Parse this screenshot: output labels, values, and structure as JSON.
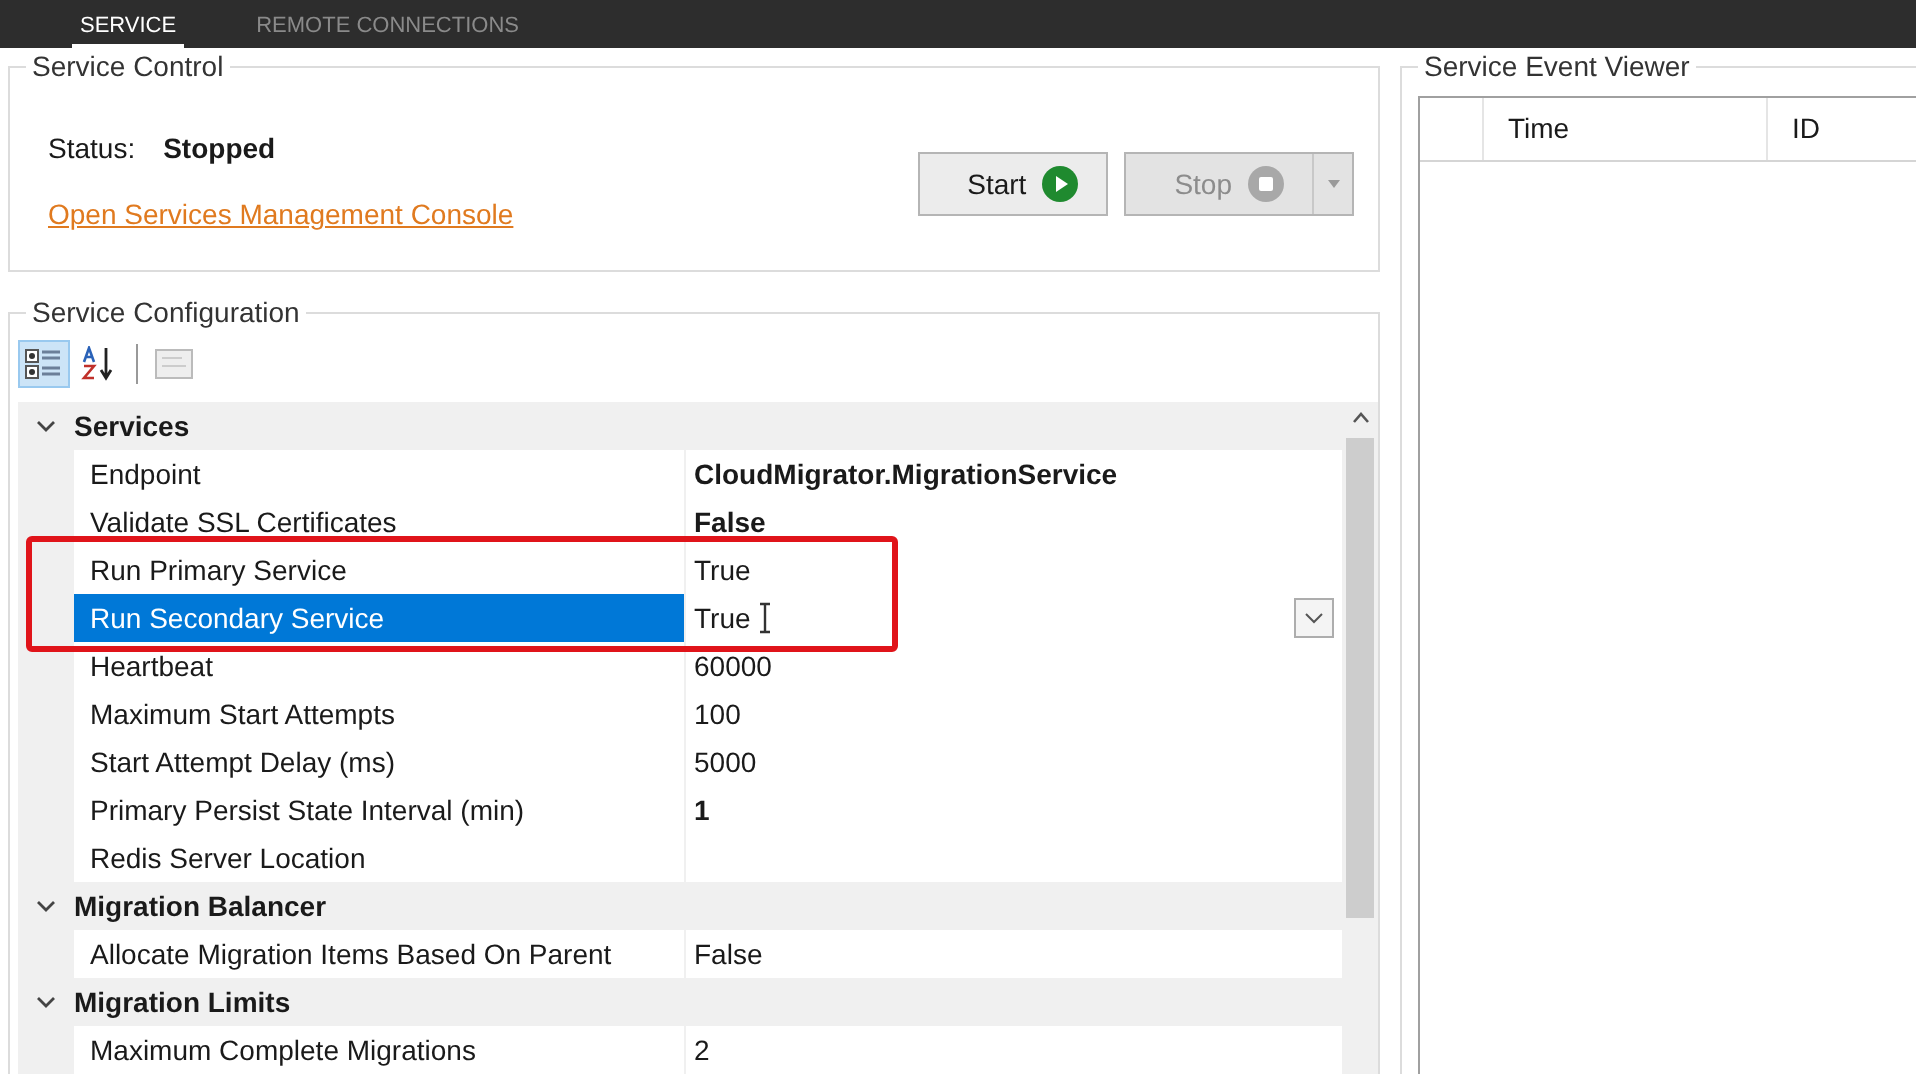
{
  "tabs": [
    {
      "label": "SERVICE",
      "selected": true
    },
    {
      "label": "REMOTE CONNECTIONS",
      "selected": false
    }
  ],
  "service_control": {
    "title": "Service Control",
    "status_label": "Status:",
    "status_value": "Stopped",
    "link": "Open Services Management Console",
    "buttons": [
      {
        "label": "Start",
        "kind": "start",
        "disabled": false
      },
      {
        "label": "Stop",
        "kind": "stop",
        "disabled": true
      }
    ]
  },
  "service_configuration": {
    "title": "Service Configuration",
    "toolbar": [
      {
        "kind": "categorized",
        "selected": true
      },
      {
        "kind": "alphabetical",
        "selected": false
      },
      {
        "kind": "pages",
        "selected": false
      }
    ],
    "categories": [
      {
        "name": "Services",
        "expanded": true,
        "properties": [
          {
            "name": "Endpoint",
            "value": "CloudMigrator.MigrationService",
            "bold": true,
            "selected": false,
            "highlighted": false
          },
          {
            "name": "Validate SSL Certificates",
            "value": "False",
            "bold": true,
            "selected": false,
            "highlighted": false
          },
          {
            "name": "Run Primary Service",
            "value": "True",
            "bold": false,
            "selected": false,
            "highlighted": true
          },
          {
            "name": "Run Secondary Service",
            "value": "True",
            "bold": false,
            "selected": true,
            "highlighted": true
          },
          {
            "name": "Heartbeat",
            "value": "60000",
            "bold": false,
            "selected": false,
            "highlighted": false
          },
          {
            "name": "Maximum Start Attempts",
            "value": "100",
            "bold": false,
            "selected": false,
            "highlighted": false
          },
          {
            "name": "Start Attempt Delay (ms)",
            "value": "5000",
            "bold": false,
            "selected": false,
            "highlighted": false
          },
          {
            "name": "Primary Persist State Interval (min)",
            "value": "1",
            "bold": true,
            "selected": false,
            "highlighted": false
          },
          {
            "name": "Redis Server Location",
            "selected": false,
            "highlighted": false
          }
        ]
      },
      {
        "name": "Migration Balancer",
        "expanded": true,
        "properties": [
          {
            "name": "Allocate Migration Items Based On Parent",
            "value": "False",
            "bold": false,
            "selected": false,
            "highlighted": false
          }
        ]
      },
      {
        "name": "Migration Limits",
        "expanded": true,
        "properties": [
          {
            "name": "Maximum Complete Migrations",
            "value": "2",
            "bold": false,
            "selected": false,
            "highlighted": false
          }
        ]
      }
    ]
  },
  "event_viewer": {
    "title": "Service Event Viewer",
    "columns": [
      "Time",
      "ID"
    ]
  }
}
